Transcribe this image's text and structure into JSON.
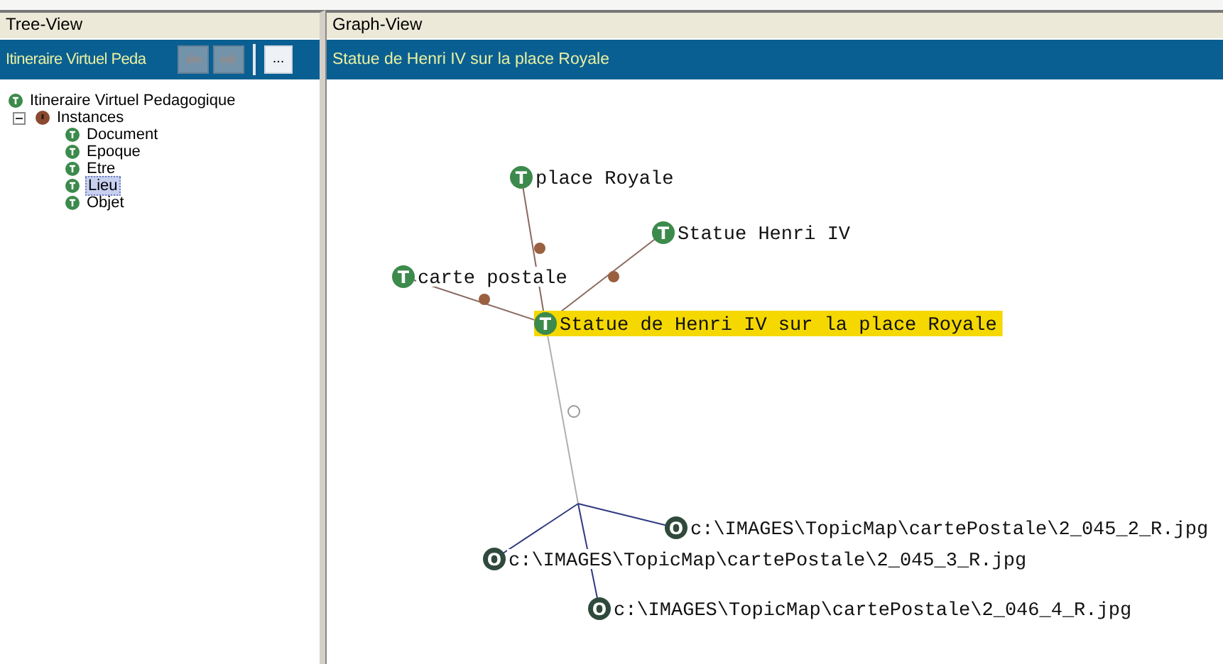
{
  "tree_view": {
    "header": "Tree-View",
    "toolbar": {
      "title": "Itineraire Virtuel Peda",
      "back_disabled": true,
      "forward_disabled": true,
      "more_button": "..."
    },
    "items": [
      {
        "label": "Itineraire Virtuel Pedagogique",
        "kind": "topic",
        "selected": false
      },
      {
        "label": "Instances",
        "kind": "association",
        "expanded": true,
        "selected": false,
        "children": [
          {
            "label": "Document",
            "kind": "topic",
            "selected": false
          },
          {
            "label": "Epoque",
            "kind": "topic",
            "selected": false
          },
          {
            "label": "Etre",
            "kind": "topic",
            "selected": false
          },
          {
            "label": "Lieu",
            "kind": "topic",
            "selected": true
          },
          {
            "label": "Objet",
            "kind": "topic",
            "selected": false
          }
        ]
      }
    ]
  },
  "graph_view": {
    "header": "Graph-View",
    "title": "Statue de Henri IV sur la place Royale",
    "nodes": [
      {
        "label": "place Royale",
        "kind": "topic",
        "badge": "T",
        "selected": false
      },
      {
        "label": "Statue Henri IV",
        "kind": "topic",
        "badge": "T",
        "selected": false
      },
      {
        "label": "carte postale",
        "kind": "topic",
        "badge": "T",
        "selected": false
      },
      {
        "label": "Statue de Henri IV sur la place Royale",
        "kind": "topic",
        "badge": "T",
        "selected": true
      },
      {
        "label": "c:\\IMAGES\\TopicMap\\cartePostale\\2_045_2_R.jpg",
        "kind": "occurrence",
        "badge": "O",
        "selected": false
      },
      {
        "label": "c:\\IMAGES\\TopicMap\\cartePostale\\2_045_3_R.jpg",
        "kind": "occurrence",
        "badge": "O",
        "selected": false
      },
      {
        "label": "c:\\IMAGES\\TopicMap\\cartePostale\\2_046_4_R.jpg",
        "kind": "occurrence",
        "badge": "O",
        "selected": false
      }
    ]
  }
}
